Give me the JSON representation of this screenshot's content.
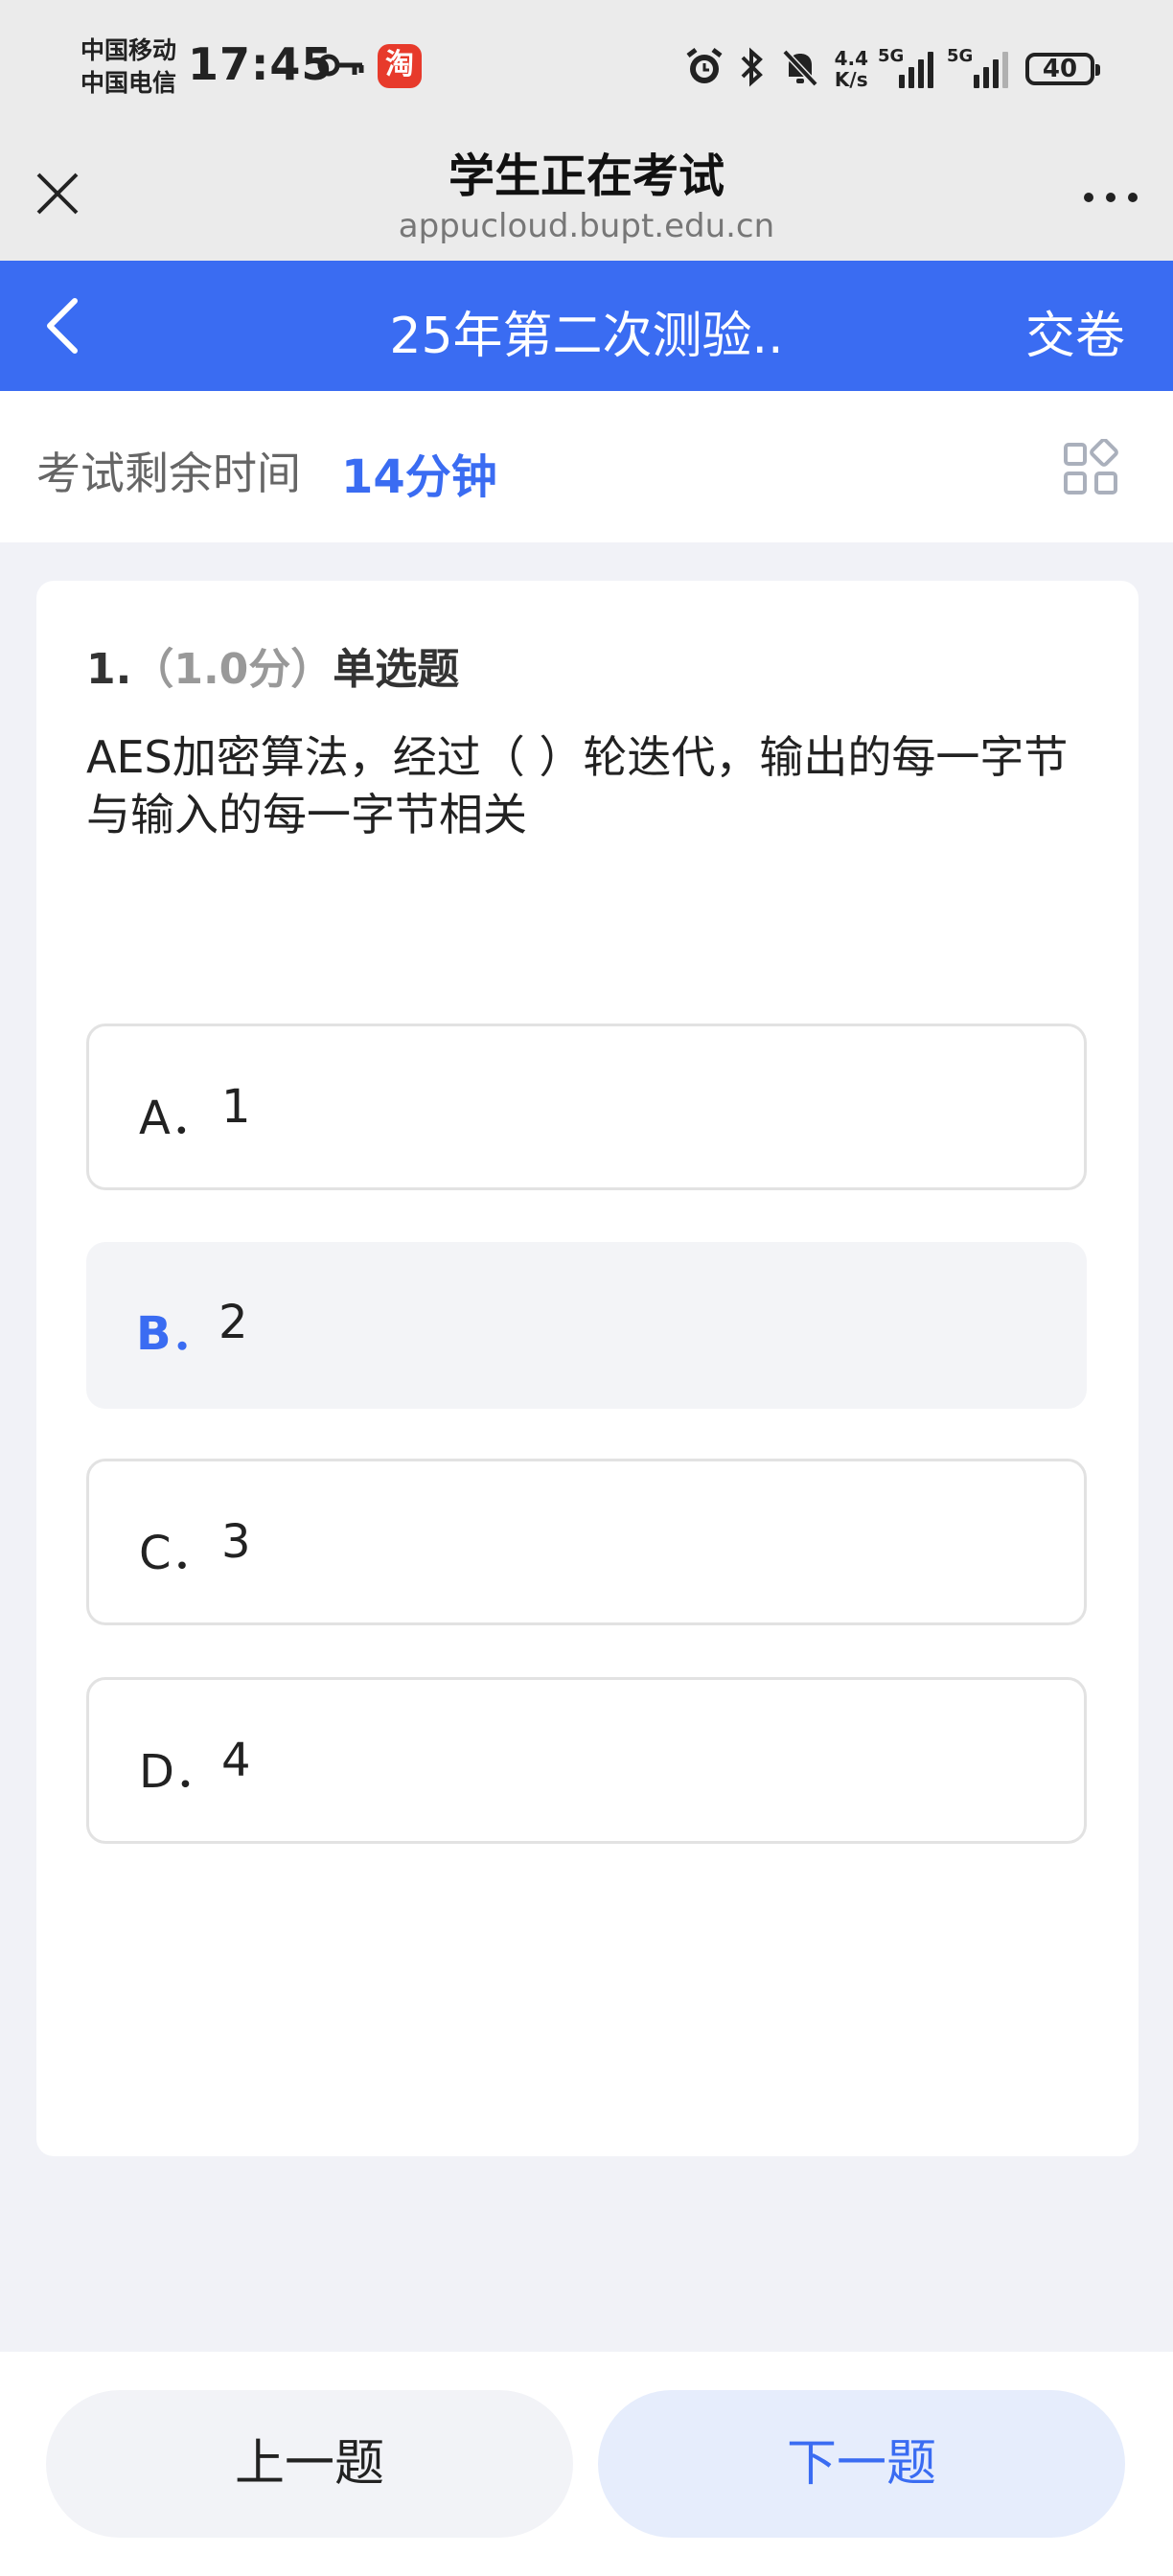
{
  "status_bar": {
    "carrier_1": "中国移动",
    "carrier_2": "中国电信",
    "time": "17:45",
    "app_icon_label": "淘",
    "net_speed_top": "4.4",
    "net_speed_bottom": "K/s",
    "signal_1_label": "5G",
    "signal_2_label": "5G",
    "battery": "40"
  },
  "web_header": {
    "title": "学生正在考试",
    "url": "appucloud.bupt.edu.cn"
  },
  "nav": {
    "title": "25年第二次测验..",
    "submit_label": "交卷"
  },
  "timer": {
    "label": "考试剩余时间",
    "value": "14分钟"
  },
  "question": {
    "number": "1.",
    "score": "（1.0分）",
    "type": "单选题",
    "text": "AES加密算法，经过（ ）轮迭代，输出的每一字节与输入的每一字节相关",
    "options": [
      {
        "letter": "A．",
        "value": "1"
      },
      {
        "letter": "B．",
        "value": "2"
      },
      {
        "letter": "C．",
        "value": "3"
      },
      {
        "letter": "D．",
        "value": "4"
      }
    ],
    "selected_option": "B"
  },
  "footer": {
    "prev_label": "上一题",
    "next_label": "下一题"
  },
  "colors": {
    "accent": "#3a6cf2",
    "page_bg": "#f1f2f7"
  }
}
